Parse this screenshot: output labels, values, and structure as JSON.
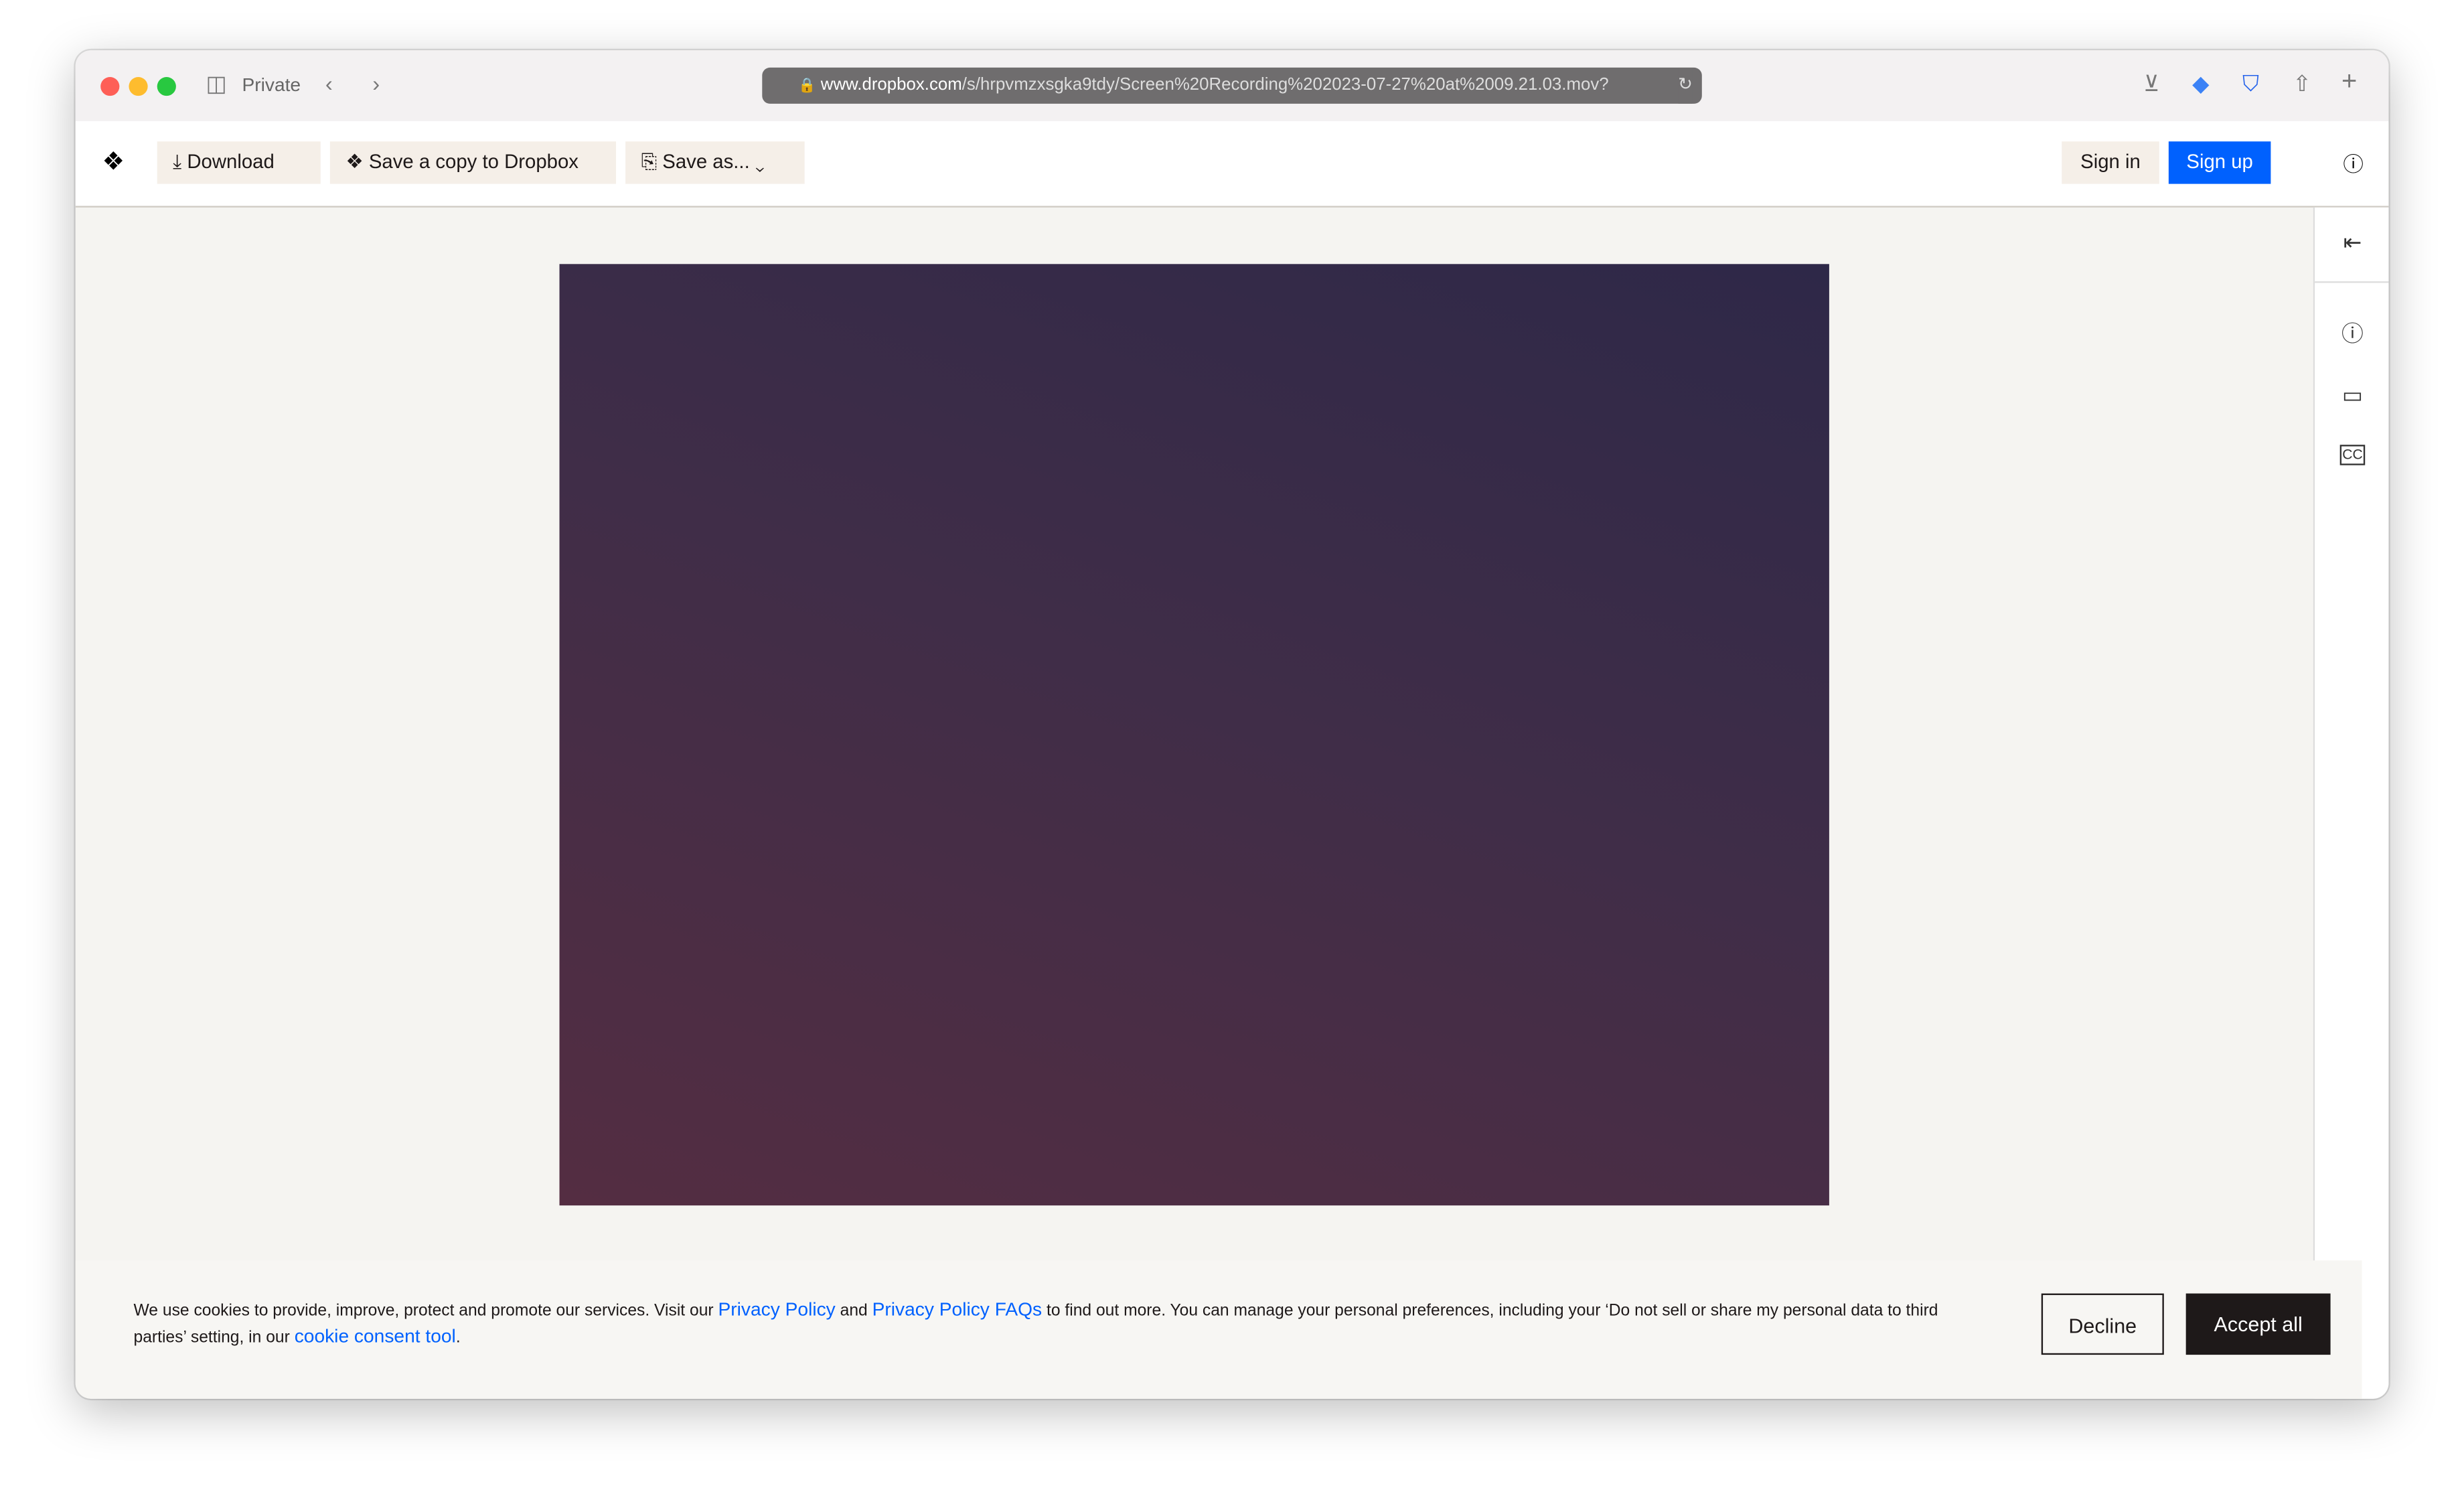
{
  "browser": {
    "mode_label": "Private",
    "url_host": "www.dropbox.com",
    "url_path": "/s/hrpvmzxsgka9tdy/Screen%20Recording%202023-07-27%20at%2009.21.03.mov?"
  },
  "toolbar": {
    "download_label": "Download",
    "save_copy_label": "Save a copy to Dropbox",
    "save_as_label": "Save as...",
    "sign_in_label": "Sign in",
    "sign_up_label": "Sign up"
  },
  "cookie": {
    "text1": "We use cookies to provide, improve, protect and promote our services. Visit our ",
    "link1": "Privacy Policy",
    "text2": " and ",
    "link2": "Privacy Policy FAQs",
    "text3": " to find out more. You can manage your personal preferences, including your ‘Do not sell or share my personal data to third parties’ setting, in our ",
    "link3": "cookie consent tool",
    "text4": ".",
    "decline_label": "Decline",
    "accept_label": "Accept all"
  },
  "colors": {
    "accent": "#0061fe",
    "button_bg": "#f5efe8"
  }
}
